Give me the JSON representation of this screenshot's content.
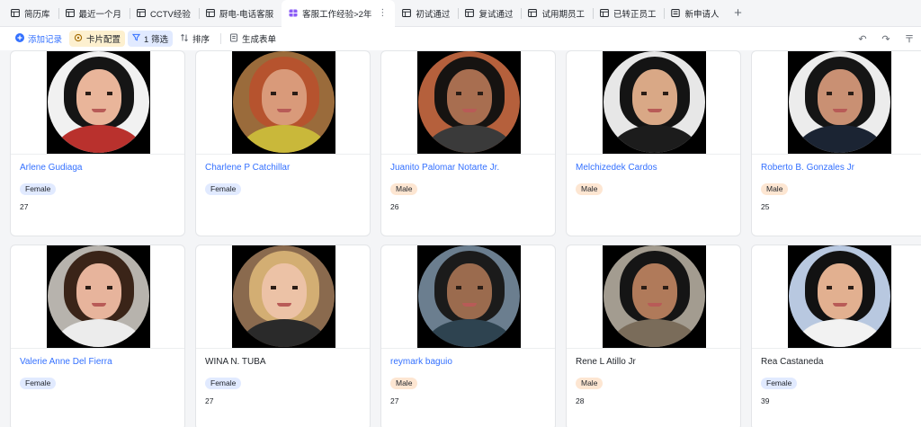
{
  "tabs": [
    {
      "label": "简历库",
      "icon": "table-icon",
      "active": false
    },
    {
      "label": "最近一个月",
      "icon": "table-icon",
      "active": false
    },
    {
      "label": "CCTV经验",
      "icon": "table-icon",
      "active": false
    },
    {
      "label": "厨电-电话客服",
      "icon": "table-icon",
      "active": false
    },
    {
      "label": "客服工作经验>2年",
      "icon": "gallery-icon",
      "active": true
    },
    {
      "label": "初试通过",
      "icon": "table-icon",
      "active": false
    },
    {
      "label": "复试通过",
      "icon": "table-icon",
      "active": false
    },
    {
      "label": "试用期员工",
      "icon": "table-icon",
      "active": false
    },
    {
      "label": "已转正员工",
      "icon": "table-icon",
      "active": false
    },
    {
      "label": "新申请人",
      "icon": "form-icon",
      "active": false
    }
  ],
  "tab_more_glyph": "⋮",
  "tab_add_glyph": "+",
  "toolbar": {
    "add_record": "添加记录",
    "card_config": "卡片配置",
    "filter": "1 筛选",
    "sort": "排序",
    "generate_form": "生成表单",
    "undo_glyph": "↶",
    "redo_glyph": "↷",
    "more_glyph": "〒"
  },
  "cards": [
    {
      "name": "Arlene Gudiaga",
      "gender": "Female",
      "age": "27",
      "bg": "#f1f1f1",
      "hair": "#151515",
      "skin": "#e9b59a",
      "body": "#b9312d",
      "name_color": "link"
    },
    {
      "name": "Charlene P Catchillar",
      "gender": "Female",
      "age": "",
      "bg": "#9a6b3b",
      "hair": "#b6532e",
      "skin": "#d99a7a",
      "body": "#c9b83a",
      "name_color": "link"
    },
    {
      "name": "Juanito Palomar Notarte Jr.",
      "gender": "Male",
      "age": "26",
      "bg": "#b5603c",
      "hair": "#161311",
      "skin": "#a86e50",
      "body": "#3a3a3a",
      "name_color": "link"
    },
    {
      "name": "Melchizedek Cardos",
      "gender": "Male",
      "age": "",
      "bg": "#e7e7e7",
      "hair": "#141414",
      "skin": "#d9a886",
      "body": "#1c1c1c",
      "name_color": "link"
    },
    {
      "name": "Roberto B. Gonzales Jr",
      "gender": "Male",
      "age": "25",
      "bg": "#ececec",
      "hair": "#151515",
      "skin": "#c99073",
      "body": "#1b2433",
      "name_color": "link"
    },
    {
      "name": "Valerie Anne Del Fierra",
      "gender": "Female",
      "age": "",
      "bg": "#b7b3ad",
      "hair": "#3a2418",
      "skin": "#e7b49c",
      "body": "#ececec",
      "name_color": "link"
    },
    {
      "name": "WINA N. TUBA",
      "gender": "Female",
      "age": "27",
      "bg": "#8a6a4e",
      "hair": "#d3ae73",
      "skin": "#ecc2a6",
      "body": "#2a2a2a",
      "name_color": "dark"
    },
    {
      "name": "reymark baguio",
      "gender": "Male",
      "age": "27",
      "bg": "#6b7e8f",
      "hair": "#1b1b1b",
      "skin": "#9b6b4e",
      "body": "#2e4350",
      "name_color": "link"
    },
    {
      "name": "Rene L Atillo Jr",
      "gender": "Male",
      "age": "28",
      "bg": "#a39c90",
      "hair": "#151515",
      "skin": "#b07a5a",
      "body": "#7a6c5a",
      "name_color": "dark"
    },
    {
      "name": "Rea Castaneda",
      "gender": "Female",
      "age": "39",
      "bg": "#b8c8e0",
      "hair": "#121212",
      "skin": "#e2b090",
      "body": "#f2f2f2",
      "name_color": "dark"
    }
  ]
}
